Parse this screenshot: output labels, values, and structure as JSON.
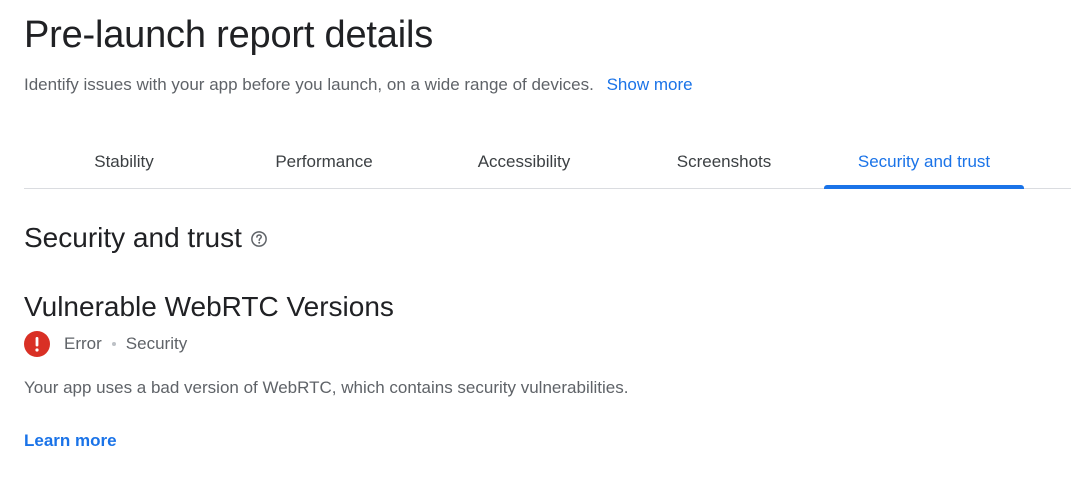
{
  "header": {
    "title": "Pre-launch report details",
    "subtitle": "Identify issues with your app before you launch, on a wide range of devices.",
    "show_more": "Show more"
  },
  "tabs": [
    {
      "label": "Stability",
      "active": false
    },
    {
      "label": "Performance",
      "active": false
    },
    {
      "label": "Accessibility",
      "active": false
    },
    {
      "label": "Screenshots",
      "active": false
    },
    {
      "label": "Security and trust",
      "active": true
    }
  ],
  "section": {
    "title": "Security and trust",
    "help_icon": "help-circle-icon"
  },
  "issue": {
    "title": "Vulnerable WebRTC Versions",
    "severity": "Error",
    "category": "Security",
    "severity_icon": "error-icon",
    "description": "Your app uses a bad version of WebRTC, which contains security vulnerabilities.",
    "learn_more": "Learn more"
  },
  "colors": {
    "accent": "#1a73e8",
    "error": "#d93025",
    "text_primary": "#202124",
    "text_secondary": "#5f6368",
    "divider": "#dadce0"
  }
}
